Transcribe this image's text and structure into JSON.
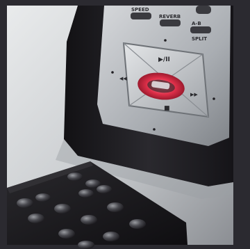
{
  "photo": {
    "subject": "digital audio player with detached remote control",
    "player_labels": {
      "speed": "SPEED",
      "reverb": "REVERB",
      "ab_repeat": "A-B",
      "split": "SPLIT",
      "play_pause": "▶/II",
      "stop": "■",
      "rewind": "◀◀",
      "fast_forward": "▶▶"
    },
    "colors": {
      "backdrop": "#2b2a30",
      "table_surface": "#cfd1d3",
      "device_body": "#1e1d21",
      "faceplate": "#b9bcc0",
      "center_button_glow": "#e0304a",
      "remote_body": "#1b1a1e"
    }
  }
}
